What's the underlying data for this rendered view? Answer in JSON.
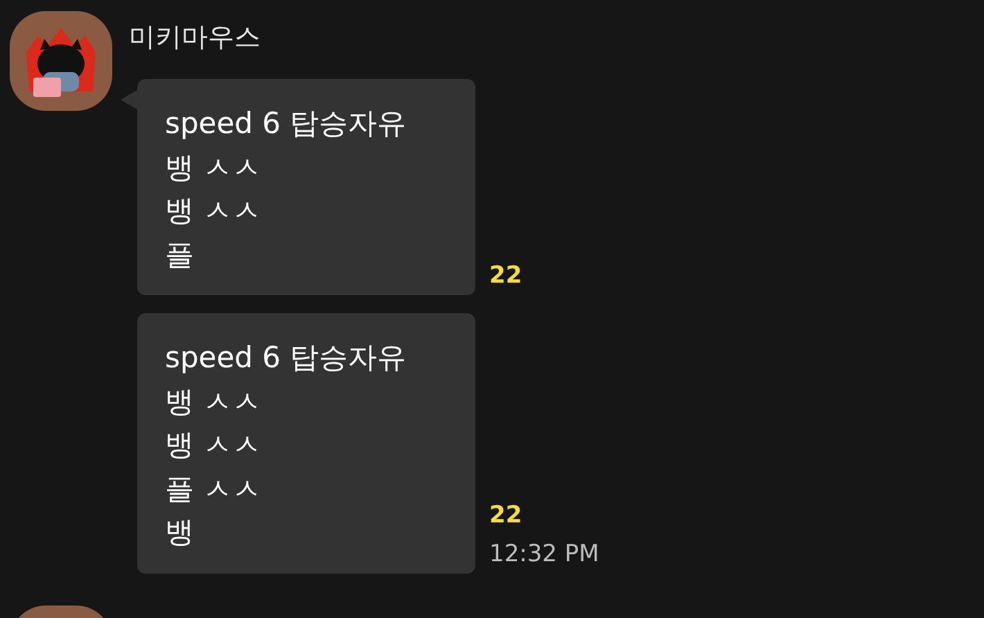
{
  "sender": {
    "name": "미키마우스"
  },
  "messages": [
    {
      "text": "speed 6 탑승자유\n뱅 ㅅㅅ\n뱅 ㅅㅅ\n플",
      "unread": "22",
      "tail": true
    },
    {
      "text": "speed 6 탑승자유\n뱅 ㅅㅅ\n뱅 ㅅㅅ\n플 ㅅㅅ\n뱅",
      "unread": "22",
      "time": "12:32 PM",
      "tail": false
    }
  ]
}
